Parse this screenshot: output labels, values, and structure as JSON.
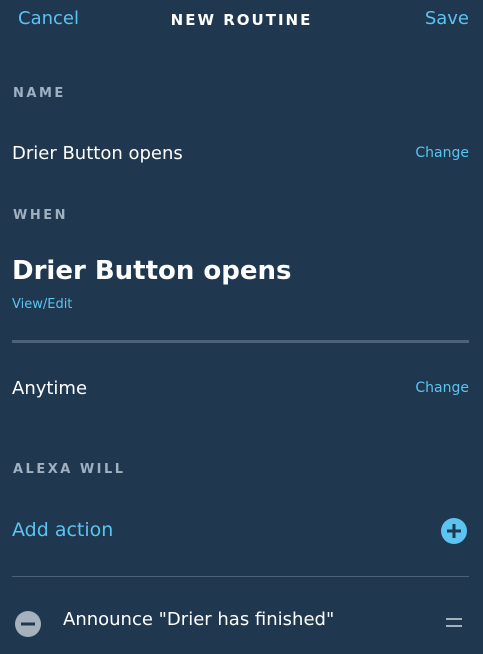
{
  "header": {
    "cancel_label": "Cancel",
    "title": "NEW ROUTINE",
    "save_label": "Save"
  },
  "name_section": {
    "label": "NAME",
    "value": "Drier Button opens",
    "change_label": "Change"
  },
  "when_section": {
    "label": "WHEN",
    "trigger": "Drier Button opens",
    "view_edit_label": "View/Edit",
    "schedule": "Anytime",
    "change_label": "Change"
  },
  "alexa_will_section": {
    "label": "ALEXA WILL",
    "add_action_label": "Add action",
    "actions": [
      {
        "text": "Announce \"Drier has finished\""
      }
    ]
  },
  "icons": {
    "add": "plus-circle-icon",
    "remove": "minus-circle-icon",
    "reorder": "drag-handle-icon"
  },
  "colors": {
    "background": "#1f374f",
    "accent": "#5bc4f1",
    "label": "#9fb0c0",
    "divider": "#4d6278"
  }
}
